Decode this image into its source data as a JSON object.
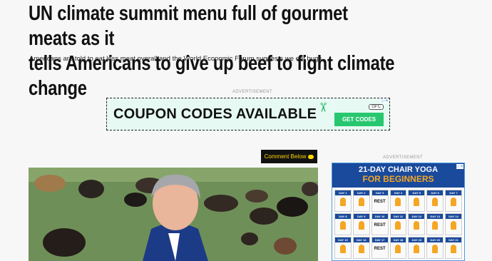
{
  "article": {
    "headline_line1": "UN climate summit menu full of gourmet meats as it",
    "headline_line2": "tells Americans to give up beef to fight climate change",
    "subheadline": "Americans are told to eat less meat overall and the World Economic Forum suggests we eat bugs."
  },
  "ads": {
    "top_label": "ADVERTISEMENT",
    "side_label": "ADVERTISEMENT",
    "coupon_text": "COUPON CODES AVAILABLE",
    "coupon_badge": "GFC",
    "coupon_button": "GET CODES",
    "yoga_title": "21-DAY CHAIR YOGA",
    "yoga_subtitle": "FOR BEGINNERS",
    "yoga_days": [
      {
        "day": "DAY 1",
        "rest": ""
      },
      {
        "day": "DAY 2",
        "rest": ""
      },
      {
        "day": "DAY 3",
        "rest": "REST"
      },
      {
        "day": "DAY 4",
        "rest": ""
      },
      {
        "day": "DAY 5",
        "rest": ""
      },
      {
        "day": "DAY 6",
        "rest": ""
      },
      {
        "day": "DAY 7",
        "rest": ""
      },
      {
        "day": "DAY 8",
        "rest": ""
      },
      {
        "day": "DAY 9",
        "rest": ""
      },
      {
        "day": "DAY 10",
        "rest": "REST"
      },
      {
        "day": "DAY 11",
        "rest": ""
      },
      {
        "day": "DAY 12",
        "rest": ""
      },
      {
        "day": "DAY 13",
        "rest": ""
      },
      {
        "day": "DAY 14",
        "rest": ""
      },
      {
        "day": "DAY 15",
        "rest": ""
      },
      {
        "day": "DAY 16",
        "rest": ""
      },
      {
        "day": "DAY 17",
        "rest": "REST"
      },
      {
        "day": "DAY 18",
        "rest": ""
      },
      {
        "day": "DAY 19",
        "rest": ""
      },
      {
        "day": "DAY 20",
        "rest": ""
      },
      {
        "day": "DAY 21",
        "rest": ""
      }
    ]
  },
  "comment_button": "Comment Below",
  "colors": {
    "coupon_bg": "#e6faf3",
    "coupon_accent": "#27c76f",
    "yoga_blue": "#1a4a9c",
    "yoga_orange": "#f5a623",
    "comment_text": "#ffd700"
  },
  "icons": {
    "scissors": "scissors-icon",
    "comment": "comment-bubble-icon",
    "adchoices": "adchoices-icon"
  }
}
